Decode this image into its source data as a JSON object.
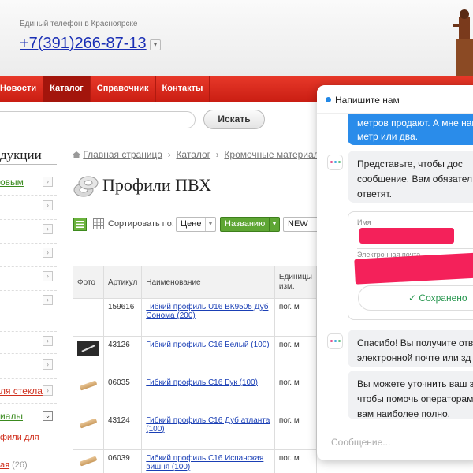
{
  "header": {
    "phone_caption": "Единый телефон в Красноярске",
    "phone": "+7(391)266-87-13"
  },
  "nav": {
    "items": [
      "Новости",
      "Каталог",
      "Справочник",
      "Контакты"
    ],
    "active": "Каталог"
  },
  "search": {
    "placeholder": "",
    "button_label": "Искать"
  },
  "sidebar": {
    "title": "дукции",
    "rows": [
      {
        "label": "овым",
        "style": "green"
      },
      {
        "label": "",
        "style": "plain"
      },
      {
        "label": "",
        "style": "plain"
      },
      {
        "label": "",
        "style": "plain"
      },
      {
        "label": "",
        "style": "plain"
      },
      {
        "label": "",
        "style": "plain"
      },
      {
        "label": "",
        "style": "plain"
      },
      {
        "label": "ля стекла",
        "style": "red"
      },
      {
        "label": "иалы",
        "style": "green"
      }
    ],
    "sub_item": "фили для",
    "last_item": "ая",
    "last_count": "(26)"
  },
  "breadcrumb": {
    "items": [
      "Главная страница",
      "Каталог",
      "Кромочные материалы"
    ]
  },
  "page": {
    "title": "Профили ПВХ"
  },
  "sort": {
    "label": "Сортировать по:",
    "options": [
      "Цене",
      "Названию",
      "NEW"
    ],
    "active": "Названию"
  },
  "table": {
    "headers": {
      "photo": "Фото",
      "article": "Артикул",
      "name": "Наименование",
      "unit_1": "Единицы",
      "unit_2": "изм."
    },
    "rows": [
      {
        "article": "159616",
        "name": "Гибкий профиль U16 ВК9505 Дуб Сонома (200)",
        "unit": "пог. м",
        "thumb": "none"
      },
      {
        "article": "43126",
        "name": "Гибкий профиль С16 Белый (100)",
        "unit": "пог. м",
        "thumb": "black"
      },
      {
        "article": "06035",
        "name": "Гибкий профиль С16 Бук (100)",
        "unit": "пог. м",
        "thumb": "wood"
      },
      {
        "article": "43124",
        "name": "Гибкий профиль С16 Дуб атланта (100)",
        "unit": "пог. м",
        "thumb": "wood"
      },
      {
        "article": "06039",
        "name": "Гибкий профиль С16 Испанская вишня (100)",
        "unit": "пог. м",
        "thumb": "wood"
      }
    ]
  },
  "chat": {
    "title": "Напишите нам",
    "msg_operator": "метров продают. А мне нам метр или два.",
    "msg_bot_1": "Представьте, чтобы дос сообщение. Вам обязател ответят.",
    "field_name_label": "Имя",
    "field_email_label": "Электронная почта",
    "saved_label": "Сохранено",
    "msg_bot_2": "Спасибо! Вы получите отв электронной почте или зд",
    "msg_bot_3": "Вы можете уточнить ваш з чтобы помочь операторам вам наиболее полно.",
    "input_placeholder": "Сообщение...",
    "colors": {
      "accent": "#2a8cea",
      "success": "#27964f",
      "redaction": "#f4215a"
    }
  },
  "colors": {
    "nav_red": "#d42a1c",
    "link_blue": "#1a3fb5",
    "sort_green": "#5ea634"
  }
}
